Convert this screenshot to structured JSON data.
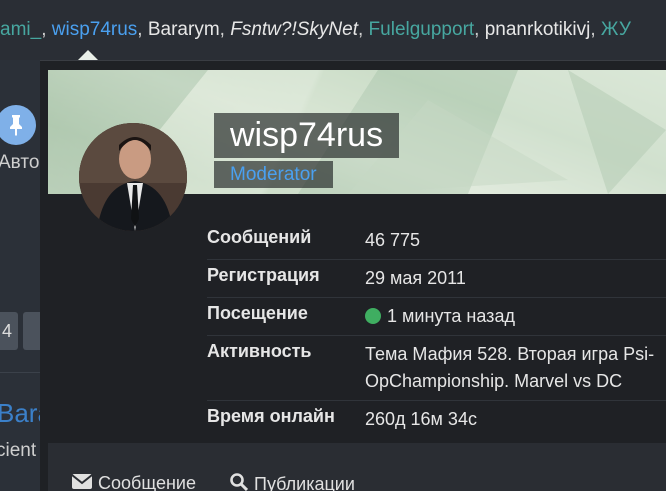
{
  "userline": [
    {
      "text": "ami_",
      "color": "teal",
      "style": "normal"
    },
    {
      "text": ", ",
      "color": "sep",
      "style": "normal"
    },
    {
      "text": "wisp74rus",
      "color": "blue",
      "style": "normal"
    },
    {
      "text": ", ",
      "color": "sep",
      "style": "normal"
    },
    {
      "text": "Bararym",
      "color": "white",
      "style": "normal"
    },
    {
      "text": ", ",
      "color": "sep",
      "style": "normal"
    },
    {
      "text": "Fsntw?!SkyNet",
      "color": "white",
      "style": "italic"
    },
    {
      "text": ", ",
      "color": "sep",
      "style": "normal"
    },
    {
      "text": "Fulelgupport",
      "color": "teal",
      "style": "normal"
    },
    {
      "text": ", ",
      "color": "sep",
      "style": "normal"
    },
    {
      "text": "pnanrkotikivj",
      "color": "white",
      "style": "normal"
    },
    {
      "text": ", ",
      "color": "sep",
      "style": "normal"
    },
    {
      "text": "ЖУ",
      "color": "teal",
      "style": "normal"
    }
  ],
  "background": {
    "avto": "Авто",
    "btn": "4",
    "bara": "Bara",
    "cient": "cient"
  },
  "profile": {
    "username": "wisp74rus",
    "role": "Moderator"
  },
  "stats": {
    "messages_label": "Сообщений",
    "messages_value": "46 775",
    "registration_label": "Регистрация",
    "registration_value": "29 мая 2011",
    "visit_label": "Посещение",
    "visit_value": "1 минута назад",
    "activity_label": "Активность",
    "activity_value": "Тема Мафия 528. Вторая игра Psi-OpChampionship. Marvel vs DC",
    "online_label": "Время онлайн",
    "online_value": "260д 16м 34с"
  },
  "footer": {
    "message_label": "Сообщение",
    "publications_label": "Публикации"
  },
  "colors": {
    "teal": "#47a7a0",
    "blue": "#4aa0f0",
    "online": "#3fae61"
  }
}
